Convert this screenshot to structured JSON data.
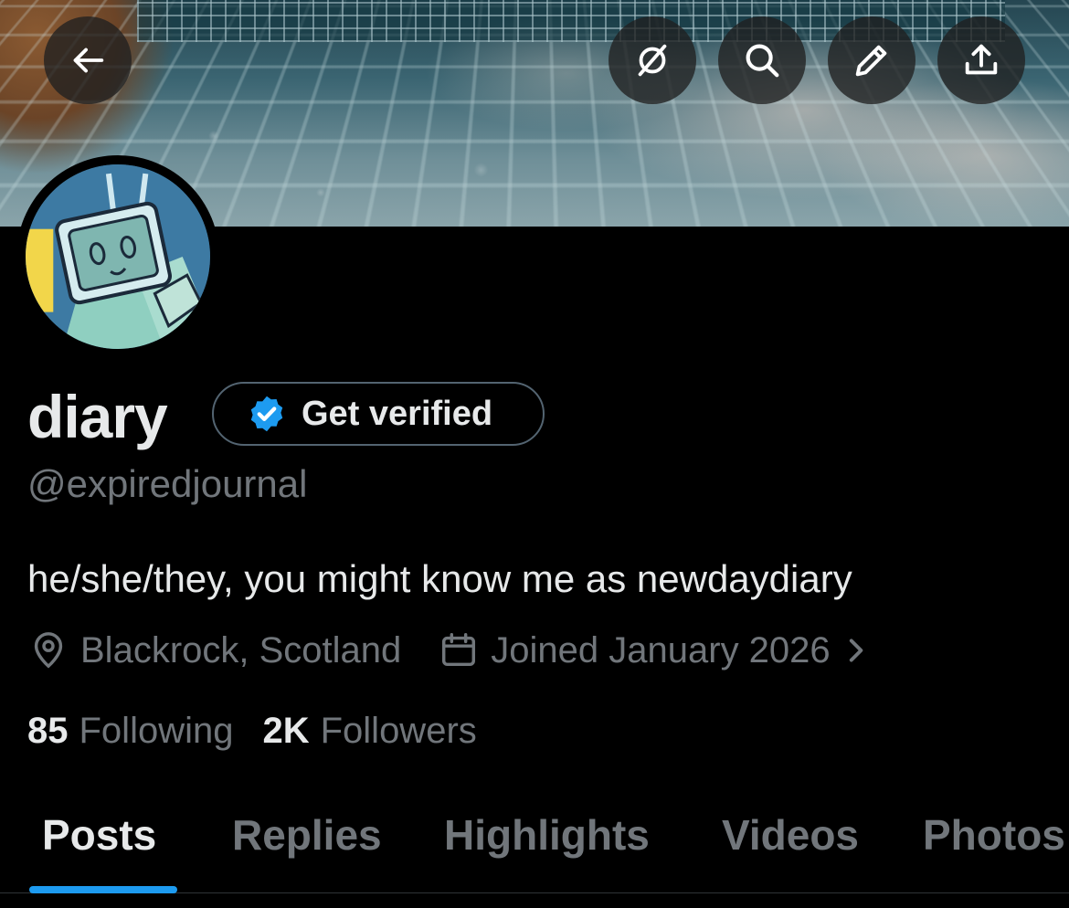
{
  "header": {
    "back_icon": "arrow-left-icon",
    "actions": [
      {
        "id": "grok",
        "icon": "grok-slash-icon"
      },
      {
        "id": "search",
        "icon": "search-icon"
      },
      {
        "id": "edit",
        "icon": "pencil-icon"
      },
      {
        "id": "share",
        "icon": "share-upload-icon"
      }
    ]
  },
  "profile": {
    "display_name": "diary",
    "verify_label": "Get verified",
    "handle": "@expiredjournal",
    "bio": "he/she/they, you might know me as newdaydiary",
    "location": "Blackrock, Scotland",
    "joined": "Joined January 2026",
    "following_count": "85",
    "following_label": "Following",
    "followers_count": "2K",
    "followers_label": "Followers"
  },
  "tabs": [
    {
      "label": "Posts",
      "active": true
    },
    {
      "label": "Replies",
      "active": false
    },
    {
      "label": "Highlights",
      "active": false
    },
    {
      "label": "Videos",
      "active": false
    },
    {
      "label": "Photos",
      "active": false
    }
  ],
  "colors": {
    "background": "#000000",
    "primary_text": "#e7e9ea",
    "secondary_text": "#71767b",
    "accent": "#1d9bf0",
    "verified_badge": "#1d9bf0"
  }
}
